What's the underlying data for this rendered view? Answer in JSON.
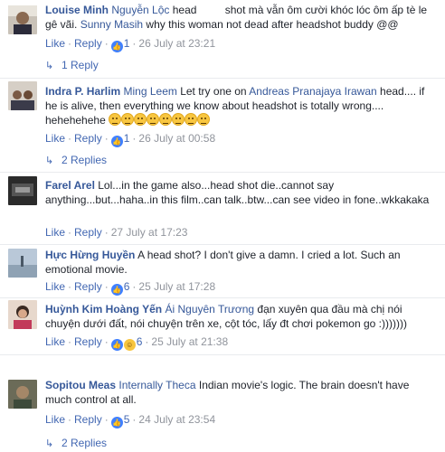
{
  "ui": {
    "like": "Like",
    "reply": "Reply",
    "dot": "·"
  },
  "colors": {
    "link": "#4267b2",
    "author": "#365899",
    "meta": "#90949c",
    "separator": "#e9ebee"
  },
  "comments": [
    {
      "author": "Louise Minh",
      "mention1": "Nguyễn Lộc",
      "text1": " head",
      "text2": " shot mà vẫn ôm cười khóc lóc ôm ấp tè le gê vãi. ",
      "mention2": "Sunny Masih",
      "text3": " why this woman not dead after headshot buddy @@",
      "reactions": "1",
      "time": "26 July at 23:21",
      "replies": "1 Reply",
      "reaction_icon": "like-icon"
    },
    {
      "author": "Indra P. Harlim",
      "mention1": "Ming Leem",
      "text1": " Let try one on ",
      "mention2": "Andreas Pranajaya Irawan",
      "text2": " head.... if he is alive, then everything we know about headshot is totally wrong.... hehehehehe",
      "reactions": "1",
      "time": "26 July at 00:58",
      "replies": "2 Replies",
      "reaction_icon": "like-icon",
      "emoji_count": 8
    },
    {
      "author": "Farel Arel",
      "text1": " Lol...in the game also...head shot die..cannot say anything...but...haha..in this film..can talk..btw...can see video in fone..wkkakaka",
      "time": "27 July at 17:23"
    },
    {
      "author": "Hực Hừng Huyền",
      "text1": " A head shot? I don't give a damn. I cried a lot. Such an emotional movie.",
      "reactions": "6",
      "time": "25 July at 17:28",
      "reaction_icon": "like-icon"
    },
    {
      "author": "Huỳnh Kim Hoàng Yến",
      "mention1": "Ái Nguyên Trương",
      "text1": " đạn xuyên qua đầu mà chị nói chuyện dưới đất, nói chuyện trên xe, cột tóc, lấy đt chơi pokemon go :)))))))",
      "reactions": "6",
      "time": "25 July at 21:38",
      "reaction_icon": "haha-like-icon"
    },
    {
      "author": "Sopitou Meas",
      "mention1": "Internally Theca",
      "text1": " Indian movie's logic. The brain doesn't have much control at all.",
      "reactions": "5",
      "time": "24 July at 23:54",
      "replies": "2 Replies",
      "reaction_icon": "like-icon"
    }
  ]
}
